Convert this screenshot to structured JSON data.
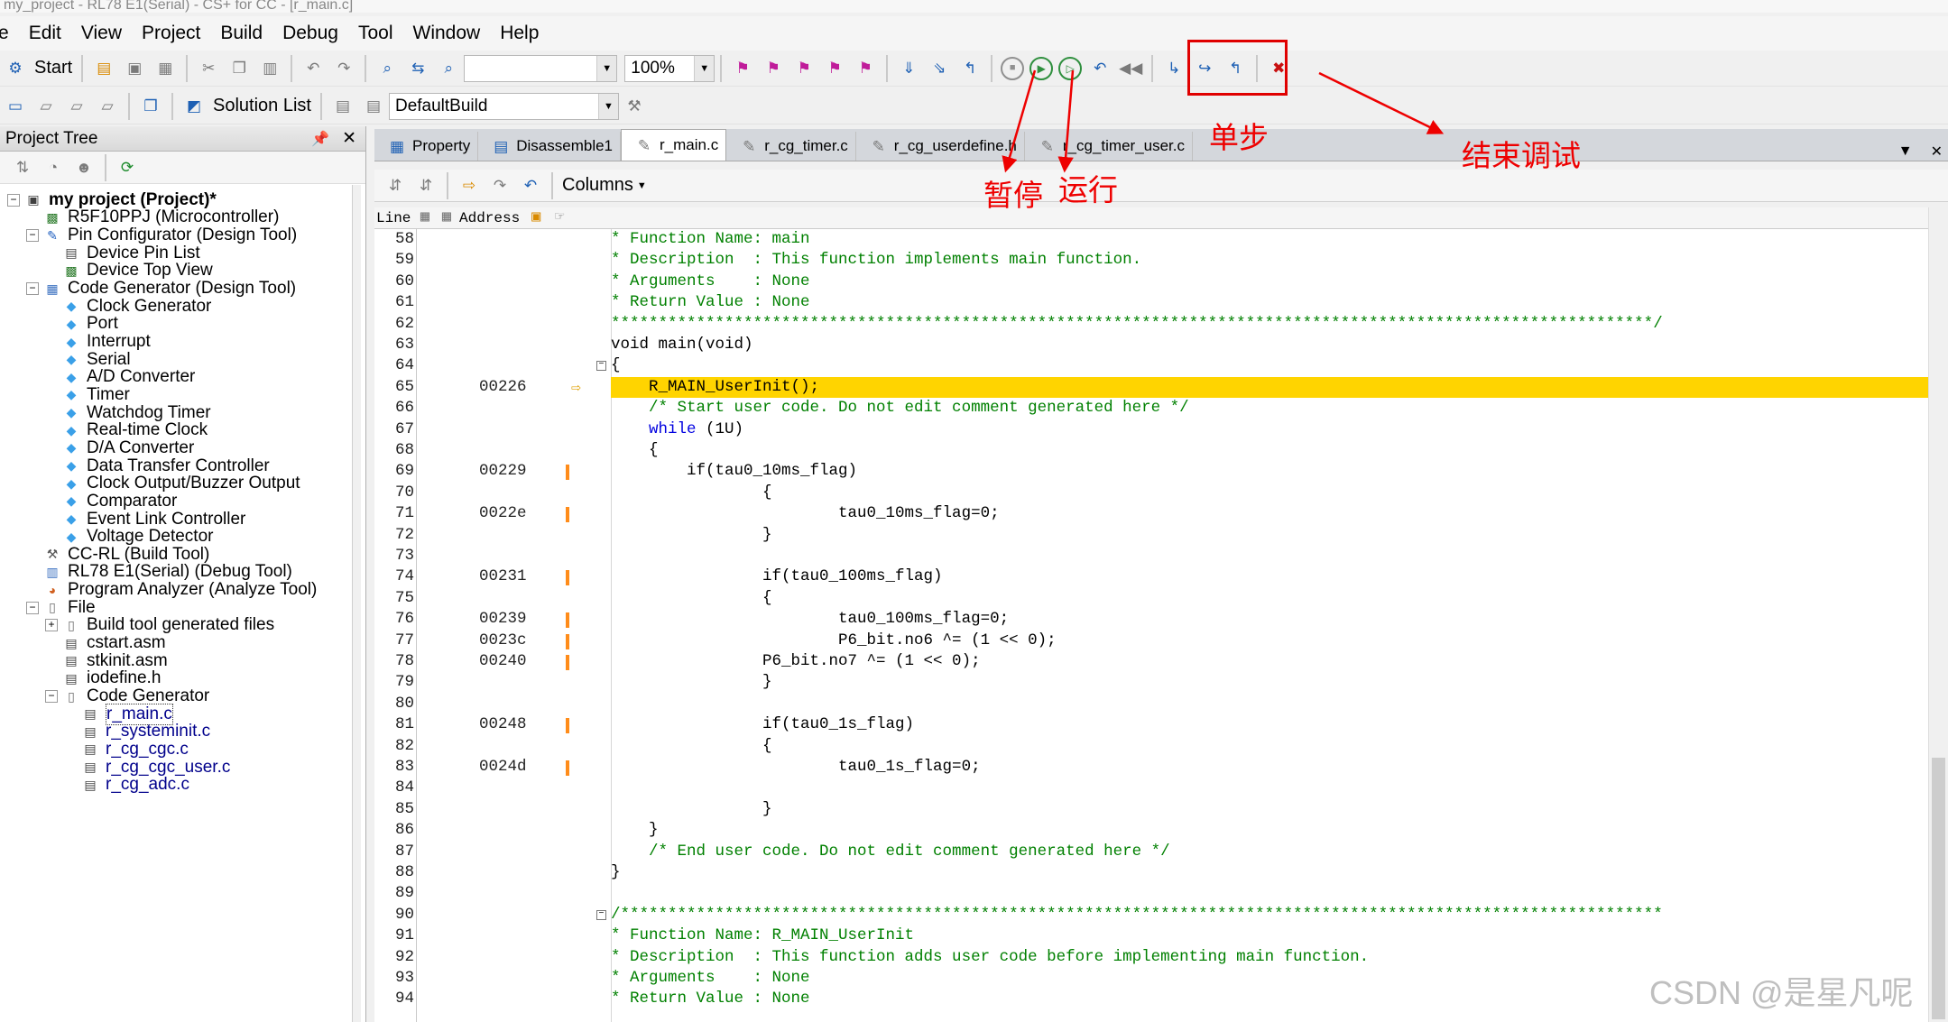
{
  "window_title": "my_project - RL78 E1(Serial) - CS+ for CC - [r_main.c]",
  "menu": [
    "e",
    "Edit",
    "View",
    "Project",
    "Build",
    "Debug",
    "Tool",
    "Window",
    "Help"
  ],
  "toolbar1": {
    "start_label": "Start",
    "zoom_value": "100%"
  },
  "toolbar2": {
    "solution_list_label": "Solution List",
    "build_config_value": "DefaultBuild"
  },
  "project_tree": {
    "title": "Project Tree",
    "pin_icon": "pin-icon",
    "items": [
      {
        "label": "my project (Project)*",
        "icon": "project-icon",
        "bold": true
      },
      {
        "label": "R5F10PPJ (Microcontroller)",
        "icon": "chip-icon"
      },
      {
        "label": "Pin Configurator (Design Tool)",
        "icon": "pin-config-icon"
      },
      {
        "label": "Device Pin List",
        "icon": "pin-list-icon"
      },
      {
        "label": "Device Top View",
        "icon": "chip-view-icon"
      },
      {
        "label": "Code Generator (Design Tool)",
        "icon": "code-gen-icon"
      },
      {
        "label": "Clock Generator",
        "icon": "module-icon"
      },
      {
        "label": "Port",
        "icon": "module-icon"
      },
      {
        "label": "Interrupt",
        "icon": "module-icon"
      },
      {
        "label": "Serial",
        "icon": "module-icon"
      },
      {
        "label": "A/D Converter",
        "icon": "module-icon"
      },
      {
        "label": "Timer",
        "icon": "module-icon"
      },
      {
        "label": "Watchdog Timer",
        "icon": "module-icon"
      },
      {
        "label": "Real-time Clock",
        "icon": "module-icon"
      },
      {
        "label": "D/A Converter",
        "icon": "module-icon"
      },
      {
        "label": "Data Transfer Controller",
        "icon": "module-icon"
      },
      {
        "label": "Clock Output/Buzzer Output",
        "icon": "module-icon"
      },
      {
        "label": "Comparator",
        "icon": "module-icon"
      },
      {
        "label": "Event Link Controller",
        "icon": "module-icon"
      },
      {
        "label": "Voltage Detector",
        "icon": "module-icon"
      },
      {
        "label": "CC-RL (Build Tool)",
        "icon": "hammer-icon"
      },
      {
        "label": "RL78 E1(Serial) (Debug Tool)",
        "icon": "debugger-icon"
      },
      {
        "label": "Program Analyzer (Analyze Tool)",
        "icon": "analyzer-icon"
      },
      {
        "label": "File",
        "icon": "folder-icon"
      },
      {
        "label": "Build tool generated files",
        "icon": "folder-icon"
      },
      {
        "label": "cstart.asm",
        "icon": "asm-file-icon"
      },
      {
        "label": "stkinit.asm",
        "icon": "asm-file-icon"
      },
      {
        "label": "iodefine.h",
        "icon": "h-file-icon"
      },
      {
        "label": "Code Generator",
        "icon": "folder-icon"
      },
      {
        "label": "r_main.c",
        "icon": "c-file-icon",
        "selected": true
      },
      {
        "label": "r_systeminit.c",
        "icon": "c-file-icon"
      },
      {
        "label": "r_cg_cgc.c",
        "icon": "c-file-icon"
      },
      {
        "label": "r_cg_cgc_user.c",
        "icon": "c-file-icon"
      },
      {
        "label": "r_cg_adc.c",
        "icon": "c-file-icon"
      }
    ]
  },
  "editor": {
    "tabs": [
      "Property",
      "Disassemble1",
      "r_main.c",
      "r_cg_timer.c",
      "r_cg_userdefine.h",
      "r_cg_timer_user.c"
    ],
    "active_tab": "r_main.c",
    "columns_label": "Columns",
    "column_headers": {
      "line": "Line",
      "address": "Address"
    },
    "lines": [
      {
        "n": "58",
        "addr": "",
        "text": "* Function Name: main",
        "cls": "com"
      },
      {
        "n": "59",
        "addr": "",
        "text": "* Description  : This function implements main function.",
        "cls": "com"
      },
      {
        "n": "60",
        "addr": "",
        "text": "* Arguments    : None",
        "cls": "com"
      },
      {
        "n": "61",
        "addr": "",
        "text": "* Return Value : None",
        "cls": "com"
      },
      {
        "n": "62",
        "addr": "",
        "text": "**************************************************************************************************************/",
        "cls": "com"
      },
      {
        "n": "63",
        "addr": "",
        "text": "void main(void)",
        "cls": ""
      },
      {
        "n": "64",
        "addr": "",
        "text": "{",
        "cls": "",
        "fold": true
      },
      {
        "n": "65",
        "addr": "00226",
        "text": "    R_MAIN_UserInit();",
        "cls": "",
        "current": true
      },
      {
        "n": "66",
        "addr": "",
        "text": "    /* Start user code. Do not edit comment generated here */",
        "cls": "com"
      },
      {
        "n": "67",
        "addr": "",
        "text": "    while (1U)",
        "cls": "kwline"
      },
      {
        "n": "68",
        "addr": "",
        "text": "    {",
        "cls": ""
      },
      {
        "n": "69",
        "addr": "00229",
        "text": "        if(tau0_10ms_flag)",
        "cls": "",
        "mark": true
      },
      {
        "n": "70",
        "addr": "",
        "text": "                {",
        "cls": ""
      },
      {
        "n": "71",
        "addr": "0022e",
        "text": "                        tau0_10ms_flag=0;",
        "cls": "",
        "mark": true
      },
      {
        "n": "72",
        "addr": "",
        "text": "                }",
        "cls": ""
      },
      {
        "n": "73",
        "addr": "",
        "text": "",
        "cls": ""
      },
      {
        "n": "74",
        "addr": "00231",
        "text": "                if(tau0_100ms_flag)",
        "cls": "",
        "mark": true
      },
      {
        "n": "75",
        "addr": "",
        "text": "                {",
        "cls": ""
      },
      {
        "n": "76",
        "addr": "00239",
        "text": "                        tau0_100ms_flag=0;",
        "cls": "",
        "mark": true
      },
      {
        "n": "77",
        "addr": "0023c",
        "text": "                        P6_bit.no6 ^= (1 << 0);",
        "cls": "",
        "mark": true
      },
      {
        "n": "78",
        "addr": "00240",
        "text": "                P6_bit.no7 ^= (1 << 0);",
        "cls": "",
        "mark": true
      },
      {
        "n": "79",
        "addr": "",
        "text": "                }",
        "cls": ""
      },
      {
        "n": "80",
        "addr": "",
        "text": "",
        "cls": ""
      },
      {
        "n": "81",
        "addr": "00248",
        "text": "                if(tau0_1s_flag)",
        "cls": "",
        "mark": true
      },
      {
        "n": "82",
        "addr": "",
        "text": "                {",
        "cls": ""
      },
      {
        "n": "83",
        "addr": "0024d",
        "text": "                        tau0_1s_flag=0;",
        "cls": "",
        "mark": true
      },
      {
        "n": "84",
        "addr": "",
        "text": "",
        "cls": ""
      },
      {
        "n": "85",
        "addr": "",
        "text": "                }",
        "cls": ""
      },
      {
        "n": "86",
        "addr": "",
        "text": "    }",
        "cls": ""
      },
      {
        "n": "87",
        "addr": "",
        "text": "    /* End user code. Do not edit comment generated here */",
        "cls": "com"
      },
      {
        "n": "88",
        "addr": "",
        "text": "}",
        "cls": ""
      },
      {
        "n": "89",
        "addr": "",
        "text": "",
        "cls": ""
      },
      {
        "n": "90",
        "addr": "",
        "text": "/**************************************************************************************************************",
        "cls": "com",
        "fold": true
      },
      {
        "n": "91",
        "addr": "",
        "text": "* Function Name: R_MAIN_UserInit",
        "cls": "com"
      },
      {
        "n": "92",
        "addr": "",
        "text": "* Description  : This function adds user code before implementing main function.",
        "cls": "com"
      },
      {
        "n": "93",
        "addr": "",
        "text": "* Arguments    : None",
        "cls": "com"
      },
      {
        "n": "94",
        "addr": "",
        "text": "* Return Value : None",
        "cls": "com"
      }
    ]
  },
  "annotations": {
    "step": "单步",
    "pause": "暂停",
    "run": "运行",
    "stop_debug": "结束调试",
    "color": "#ee0000"
  },
  "watermark": "CSDN @是星凡呢",
  "colors": {
    "current_line": "#ffd400",
    "breakpoint_mark": "#ff8c1a",
    "comment": "#008000",
    "keyword": "#0000e0"
  }
}
